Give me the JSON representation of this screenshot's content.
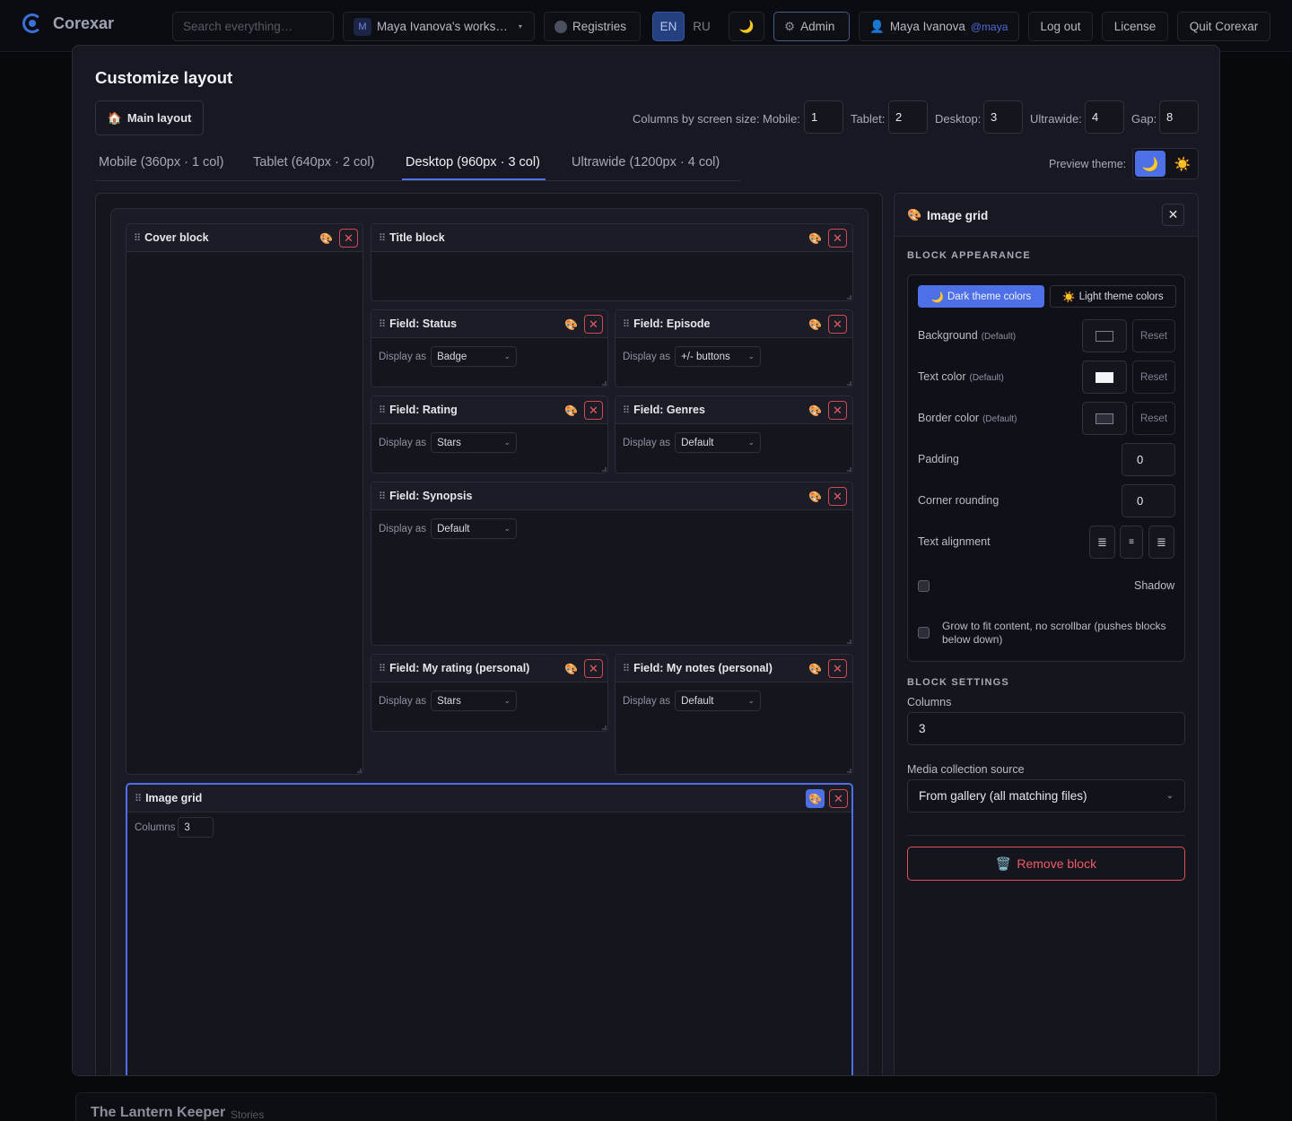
{
  "topbar": {
    "app_name": "Corexar",
    "search_placeholder": "Search everything…",
    "workspace_initial": "M",
    "workspace": "Maya Ivanova's works…",
    "registries": "Registries",
    "lang_en": "EN",
    "lang_ru": "RU",
    "theme_toggle": "🌙",
    "admin": "Admin",
    "user_name": "Maya Ivanova",
    "user_handle": "@maya",
    "logout": "Log out",
    "license": "License",
    "quit": "Quit Corexar"
  },
  "modal": {
    "title": "Customize layout",
    "main_layout_button": "Main layout",
    "columns_label": "Columns by screen size:",
    "sizes": [
      {
        "label": "Mobile:",
        "value": "1"
      },
      {
        "label": "Tablet:",
        "value": "2"
      },
      {
        "label": "Desktop:",
        "value": "3"
      },
      {
        "label": "Ultrawide:",
        "value": "4"
      },
      {
        "label": "Gap:",
        "value": "8"
      }
    ],
    "tabs": [
      {
        "label": "Mobile (360px · 1 col)"
      },
      {
        "label": "Tablet (640px · 2 col)"
      },
      {
        "label": "Desktop (960px · 3 col)",
        "active": true
      },
      {
        "label": "Ultrawide (1200px · 4 col)"
      }
    ],
    "preview_theme_label": "Preview theme:",
    "preview_dark": "🌙",
    "preview_light": "☀️"
  },
  "blocks": {
    "display_as": "Display as",
    "cover": {
      "title": "Cover block"
    },
    "title": {
      "title": "Title block"
    },
    "status": {
      "title": "Field: Status",
      "display": "Badge"
    },
    "episode": {
      "title": "Field: Episode",
      "display": "+/- buttons"
    },
    "rating": {
      "title": "Field: Rating",
      "display": "Stars"
    },
    "genres": {
      "title": "Field: Genres",
      "display": "Default"
    },
    "synopsis": {
      "title": "Field: Synopsis",
      "display": "Default"
    },
    "my_rating": {
      "title": "Field: My rating (personal)",
      "display": "Stars"
    },
    "my_notes": {
      "title": "Field: My notes (personal)",
      "display": "Default"
    },
    "image_grid": {
      "title": "Image grid",
      "columns_label": "Columns",
      "columns_value": "3"
    }
  },
  "panel": {
    "title": "Image grid",
    "appearance_heading": "BLOCK APPEARANCE",
    "dark_colors": "Dark theme colors",
    "light_colors": "Light theme colors",
    "background": "Background",
    "text_color": "Text color",
    "border_color": "Border color",
    "default_tag": "(Default)",
    "reset": "Reset",
    "padding": "Padding",
    "padding_value": "0",
    "corner_rounding": "Corner rounding",
    "corner_value": "0",
    "text_alignment": "Text alignment",
    "shadow": "Shadow",
    "grow": "Grow to fit content, no scrollbar (pushes blocks below down)",
    "settings_heading": "BLOCK SETTINGS",
    "columns_label": "Columns",
    "columns_value": "3",
    "media_source_label": "Media collection source",
    "media_source_value": "From gallery (all matching files)",
    "remove": "Remove block",
    "accent": "#4d6fe8",
    "danger": "#e0505c"
  },
  "background_item": {
    "title": "The Lantern Keeper",
    "subtitle": "Stories"
  }
}
